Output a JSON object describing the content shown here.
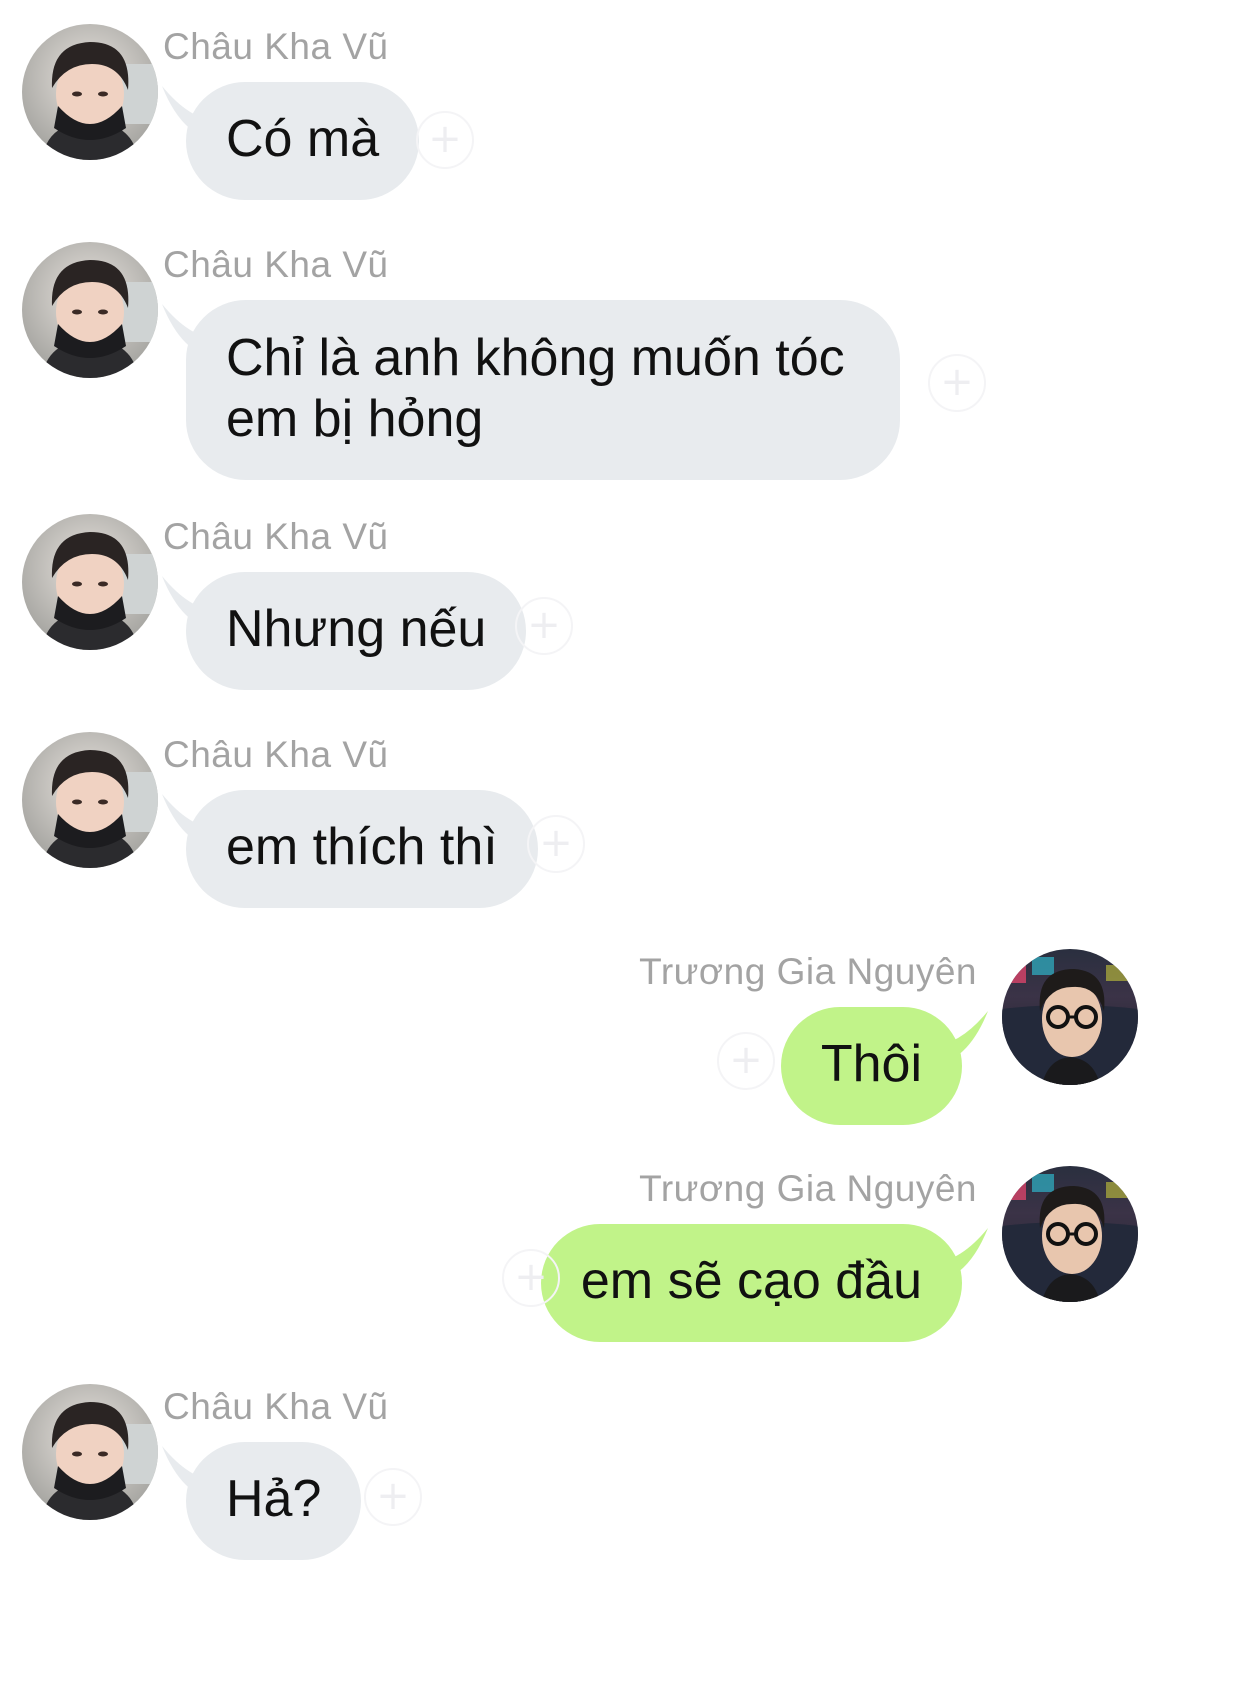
{
  "colors": {
    "incoming_bubble": "#e8ebee",
    "outgoing_bubble": "#c1f389",
    "sender_name": "#a3a3a3",
    "text": "#111111"
  },
  "messages": [
    {
      "sender": "Châu Kha Vũ",
      "text": "Có mà",
      "direction": "incoming",
      "reaction_icon": "add-reaction-icon"
    },
    {
      "sender": "Châu Kha Vũ",
      "text": "Chỉ là anh không muốn tóc em bị hỏng",
      "direction": "incoming",
      "reaction_icon": "add-reaction-icon"
    },
    {
      "sender": "Châu Kha Vũ",
      "text": "Nhưng nếu",
      "direction": "incoming",
      "reaction_icon": "add-reaction-icon"
    },
    {
      "sender": "Châu Kha Vũ",
      "text": "em thích thì",
      "direction": "incoming",
      "reaction_icon": "add-reaction-icon"
    },
    {
      "sender": "Trương Gia Nguyên",
      "text": "Thôi",
      "direction": "outgoing",
      "reaction_icon": "add-reaction-icon"
    },
    {
      "sender": "Trương Gia Nguyên",
      "text": "em sẽ cạo đầu",
      "direction": "outgoing",
      "reaction_icon": "add-reaction-icon"
    },
    {
      "sender": "Châu Kha Vũ",
      "text": "Hả?",
      "direction": "incoming",
      "reaction_icon": "add-reaction-icon"
    }
  ]
}
